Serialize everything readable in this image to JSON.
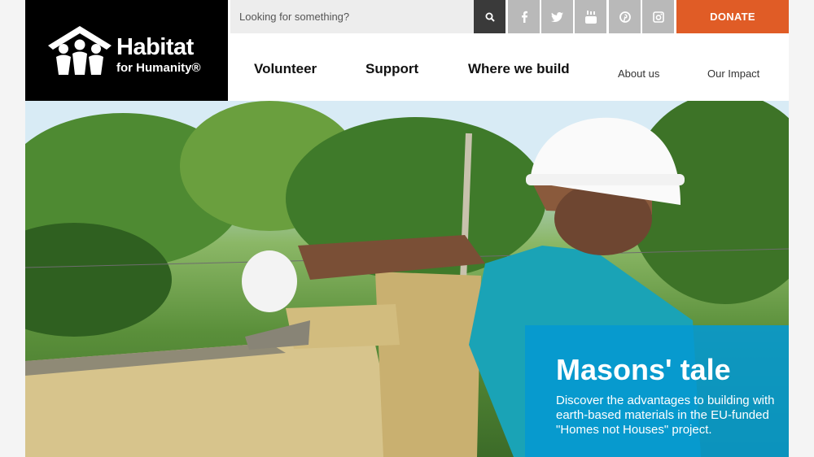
{
  "brand": {
    "title": "Habitat",
    "subtitle": "for Humanity®"
  },
  "search": {
    "placeholder": "Looking for something?"
  },
  "social": [
    "facebook-icon",
    "twitter-icon",
    "youtube-icon",
    "pinterest-icon",
    "instagram-icon"
  ],
  "donate": {
    "label": "DONATE"
  },
  "nav": {
    "primary": [
      "Volunteer",
      "Support",
      "Where we build"
    ],
    "secondary": [
      "About us",
      "Our Impact"
    ]
  },
  "hero": {
    "title": "Masons' tale",
    "text": "Discover the advantages to building with earth-based materials in the EU-funded \"Homes not Houses\" project."
  },
  "colors": {
    "accent": "#e05c26",
    "card": "#0498d2",
    "logo_bg": "#000000"
  }
}
